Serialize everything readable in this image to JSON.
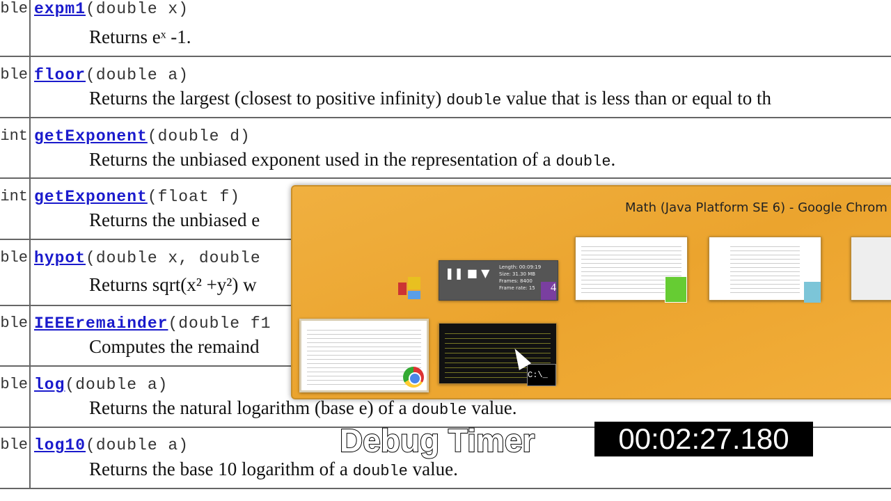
{
  "methods": [
    {
      "type": "double",
      "name": "expm1",
      "params": "(double x)",
      "desc": "Returns eˣ -1."
    },
    {
      "type": "double",
      "name": "floor",
      "params": "(double a)",
      "desc_pre": "Returns the largest (closest to positive infinity) ",
      "code": "double",
      "desc_post": " value that is less than or equal to th"
    },
    {
      "type": "int",
      "name": "getExponent",
      "params": "(double d)",
      "desc_pre": "Returns the unbiased exponent used in the representation of a ",
      "code": "double",
      "desc_post": "."
    },
    {
      "type": "int",
      "name": "getExponent",
      "params": "(float f)",
      "desc": "Returns the unbiased e"
    },
    {
      "type": "double",
      "name": "hypot",
      "params": "(double x, double",
      "desc": "Returns sqrt(x² +y²) w"
    },
    {
      "type": "double",
      "name": "IEEEremainder",
      "params": "(double f1",
      "desc": "Computes the remaind"
    },
    {
      "type": "double",
      "name": "log",
      "params": "(double a)",
      "desc_pre": "Returns the natural logarithm (base e) of a ",
      "code": "double",
      "desc_post": " value."
    },
    {
      "type": "double",
      "name": "log10",
      "params": "(double a)",
      "desc_pre": "Returns the base 10 logarithm of a ",
      "code": "double",
      "desc_post": " value."
    }
  ],
  "switcher": {
    "title": "Math (Java Platform SE 6) - Google Chrom",
    "recorder": {
      "length": "Length: 00:09:19",
      "size": "Size: 31.30 MB",
      "frames": "Frames: 8400",
      "rate": "Frame rate: 15"
    },
    "cmd_icon": "C:\\_"
  },
  "overlay": {
    "label": "Debug Timer",
    "time": "00:02:27.180"
  }
}
